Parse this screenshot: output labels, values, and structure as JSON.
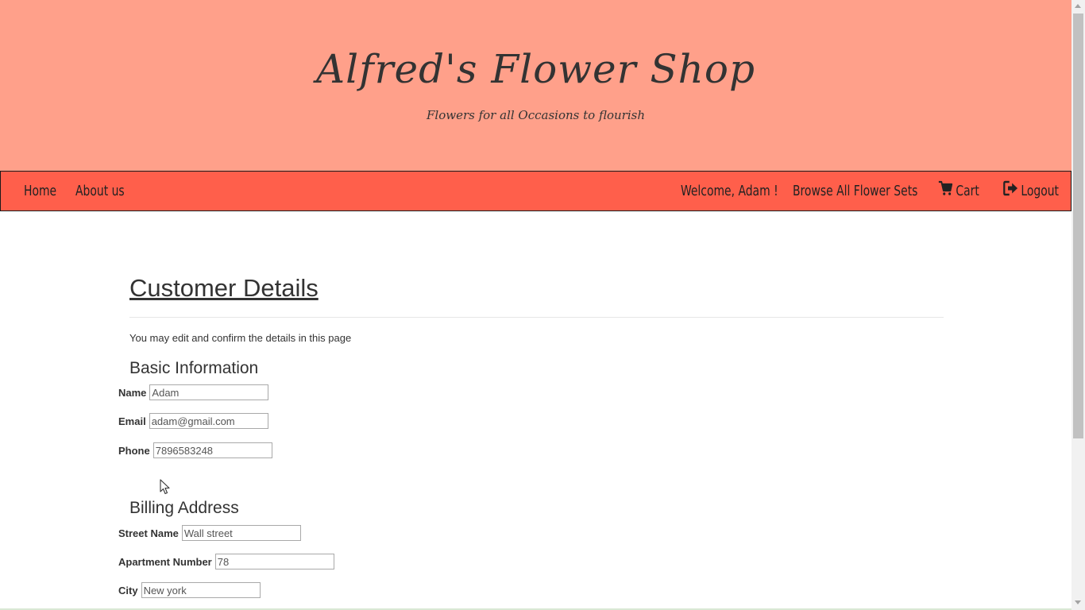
{
  "header": {
    "title": "Alfred's Flower Shop",
    "tagline": "Flowers for all Occasions to flourish",
    "background_color": "#ffa08a"
  },
  "navbar": {
    "background_color": "#ff5f4b",
    "home": "Home",
    "about": "About us",
    "welcome": "Welcome, Adam !",
    "browse": "Browse All Flower Sets",
    "cart": "Cart",
    "cart_icon": "cart-icon",
    "logout": "Logout",
    "logout_icon": "logout-icon"
  },
  "main": {
    "title": "Customer Details",
    "intro": "You may edit and confirm the details in this page",
    "basic": {
      "heading": "Basic Information",
      "name_label": "Name",
      "name_value": "Adam",
      "email_label": "Email",
      "email_value": "adam@gmail.com",
      "phone_label": "Phone",
      "phone_value": "7896583248"
    },
    "billing": {
      "heading": "Billing Address",
      "street_label": "Street Name",
      "street_value": "Wall street",
      "apartment_label": "Apartment Number",
      "apartment_value": "78",
      "city_label": "City",
      "city_value": "New york"
    }
  }
}
